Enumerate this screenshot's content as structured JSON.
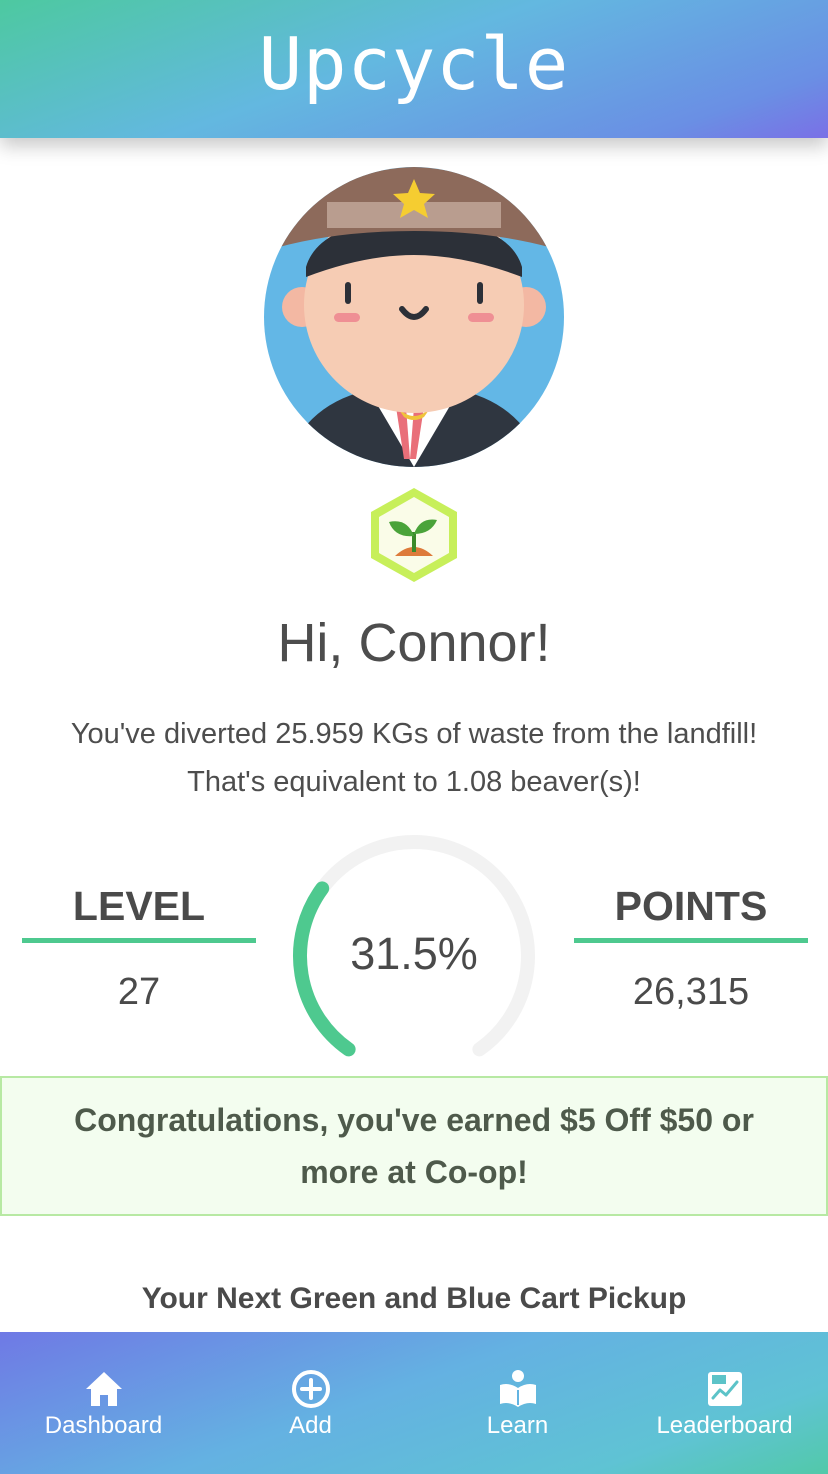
{
  "app": {
    "title": "Upcycle"
  },
  "profile": {
    "greeting": "Hi, Connor!",
    "diverted_line1": "You've diverted 25.959 KGs of waste from the landfill!",
    "diverted_line2": "That's equivalent to 1.08 beaver(s)!"
  },
  "stats": {
    "level_label": "LEVEL",
    "level_value": "27",
    "points_label": "POINTS",
    "points_value": "26,315",
    "progress_text": "31.5%",
    "progress_fraction": 0.315
  },
  "reward": {
    "message": "Congratulations, you've earned $5 Off $50 or more at Co-op!"
  },
  "pickup": {
    "title": "Your Next Green and Blue Cart Pickup"
  },
  "nav": {
    "items": [
      {
        "label": "Dashboard",
        "icon": "home-icon"
      },
      {
        "label": "Add",
        "icon": "plus-circle-icon"
      },
      {
        "label": "Learn",
        "icon": "book-reader-icon"
      },
      {
        "label": "Leaderboard",
        "icon": "leaderboard-chart-icon"
      }
    ]
  },
  "colors": {
    "accent_green": "#4ec98f",
    "gauge_track": "#f2f2f2",
    "reward_bg": "#f3fdef",
    "reward_border": "#b7e9a3"
  }
}
